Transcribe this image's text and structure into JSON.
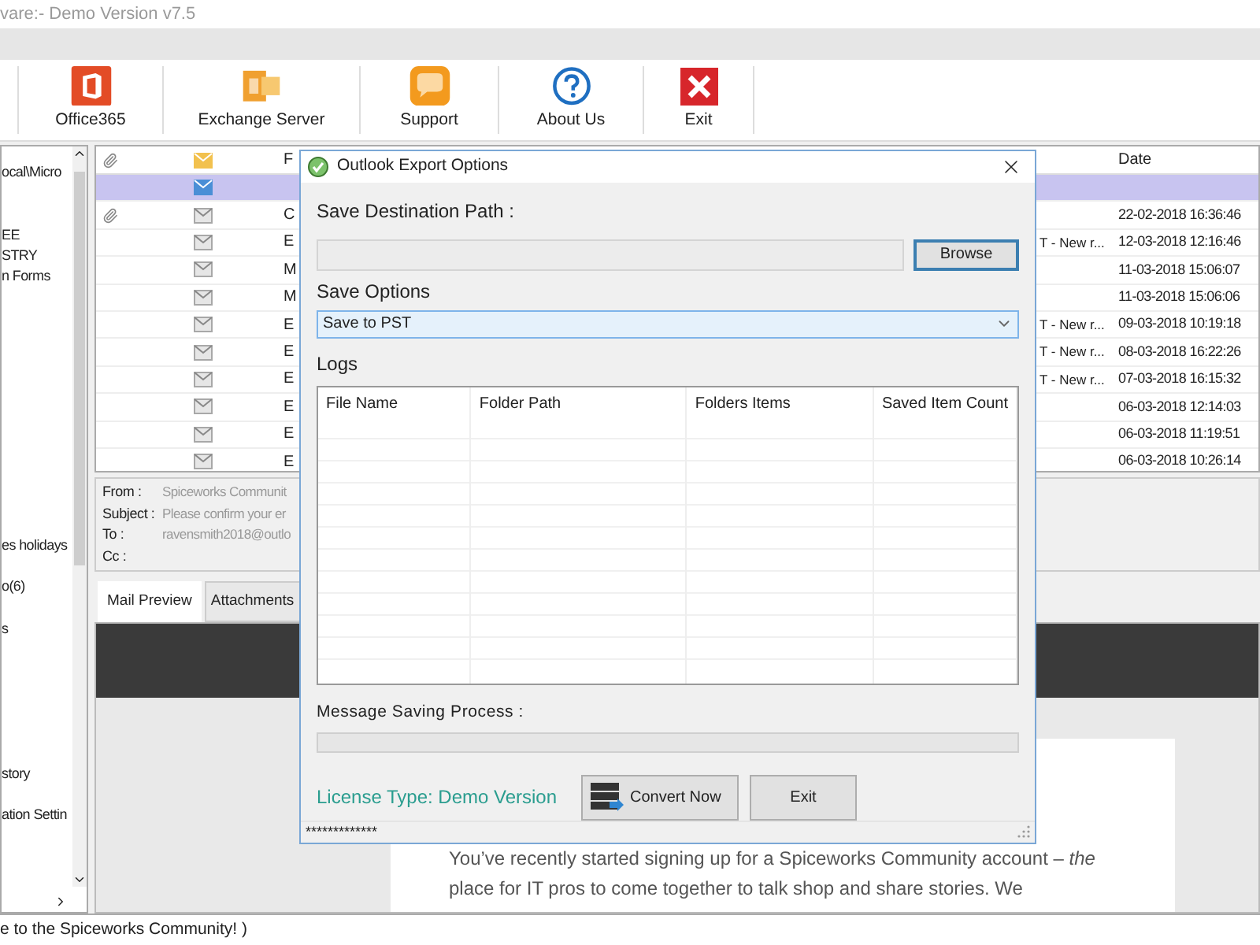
{
  "window": {
    "title": "vare:- Demo Version v7.5"
  },
  "toolbar": [
    {
      "label": "Office365",
      "kind": "office"
    },
    {
      "label": "Exchange Server",
      "kind": "exchange"
    },
    {
      "label": "Support",
      "kind": "support"
    },
    {
      "label": "About Us",
      "kind": "about"
    },
    {
      "label": "Exit",
      "kind": "exit"
    }
  ],
  "folder_tree": {
    "items": [
      {
        "label": "ocal\\Micro"
      },
      {
        "label": "EE"
      },
      {
        "label": "STRY"
      },
      {
        "label": "n Forms"
      },
      {
        "label": "es holidays"
      },
      {
        "label": "o(6)"
      },
      {
        "label": "s"
      },
      {
        "label": "story"
      },
      {
        "label": "ation Settin"
      }
    ]
  },
  "mail_list": {
    "columns": [
      {
        "label": "F"
      },
      {
        "label": "Date"
      }
    ],
    "rows": [
      {
        "selected": true,
        "attachment": false
      },
      {
        "selected": false,
        "attachment": true,
        "from": "C",
        "date": "22-02-2018 16:36:46"
      },
      {
        "selected": false,
        "attachment": false,
        "from": "E",
        "subject": "T - New r...",
        "date": "12-03-2018 12:16:46"
      },
      {
        "selected": false,
        "attachment": false,
        "from": "M",
        "date": "11-03-2018 15:06:07"
      },
      {
        "selected": false,
        "attachment": false,
        "from": "M",
        "date": "11-03-2018 15:06:06"
      },
      {
        "selected": false,
        "attachment": false,
        "from": "E",
        "subject": "T - New r...",
        "date": "09-03-2018 10:19:18"
      },
      {
        "selected": false,
        "attachment": false,
        "from": "E",
        "subject": "T - New r...",
        "date": "08-03-2018 16:22:26"
      },
      {
        "selected": false,
        "attachment": false,
        "from": "E",
        "subject": "T - New r...",
        "date": "07-03-2018 16:15:32"
      },
      {
        "selected": false,
        "attachment": false,
        "from": "E",
        "date": "06-03-2018 12:14:03"
      },
      {
        "selected": false,
        "attachment": false,
        "from": "E",
        "date": "06-03-2018 11:19:51"
      },
      {
        "selected": false,
        "attachment": false,
        "from": "E",
        "date": "06-03-2018 10:26:14"
      }
    ]
  },
  "mail_header": [
    {
      "label": "From :",
      "value": "Spiceworks Communit"
    },
    {
      "label": "Subject :",
      "value": "Please confirm your er"
    },
    {
      "label": "To :",
      "value": "ravensmith2018@outlo"
    },
    {
      "label": "Cc :"
    }
  ],
  "preview_tabs": [
    {
      "label": "Mail Preview",
      "selected": true
    },
    {
      "label": "Attachments",
      "selected": false
    }
  ],
  "preview": {
    "text": "You’ve recently started signing up for a Spiceworks Community account – *the* place for IT pros to come together to talk shop and share stories. We"
  },
  "status_bar": "e to the Spiceworks Community! )",
  "dialog": {
    "title": "Outlook Export Options",
    "destination_label": "Save Destination Path :",
    "browse_button": "Browse",
    "save_options_label": "Save Options",
    "save_option": "Save to PST",
    "logs_label": "Logs",
    "logs_columns": [
      "File Name",
      "Folder Path",
      "Folders Items",
      "Saved Item Count"
    ],
    "progress_label": "Message Saving Process :",
    "progress": {
      "level": 0
    },
    "license": "License Type: Demo Version",
    "convert_button": "Convert Now",
    "exit_button": "Exit",
    "status": "*************"
  }
}
